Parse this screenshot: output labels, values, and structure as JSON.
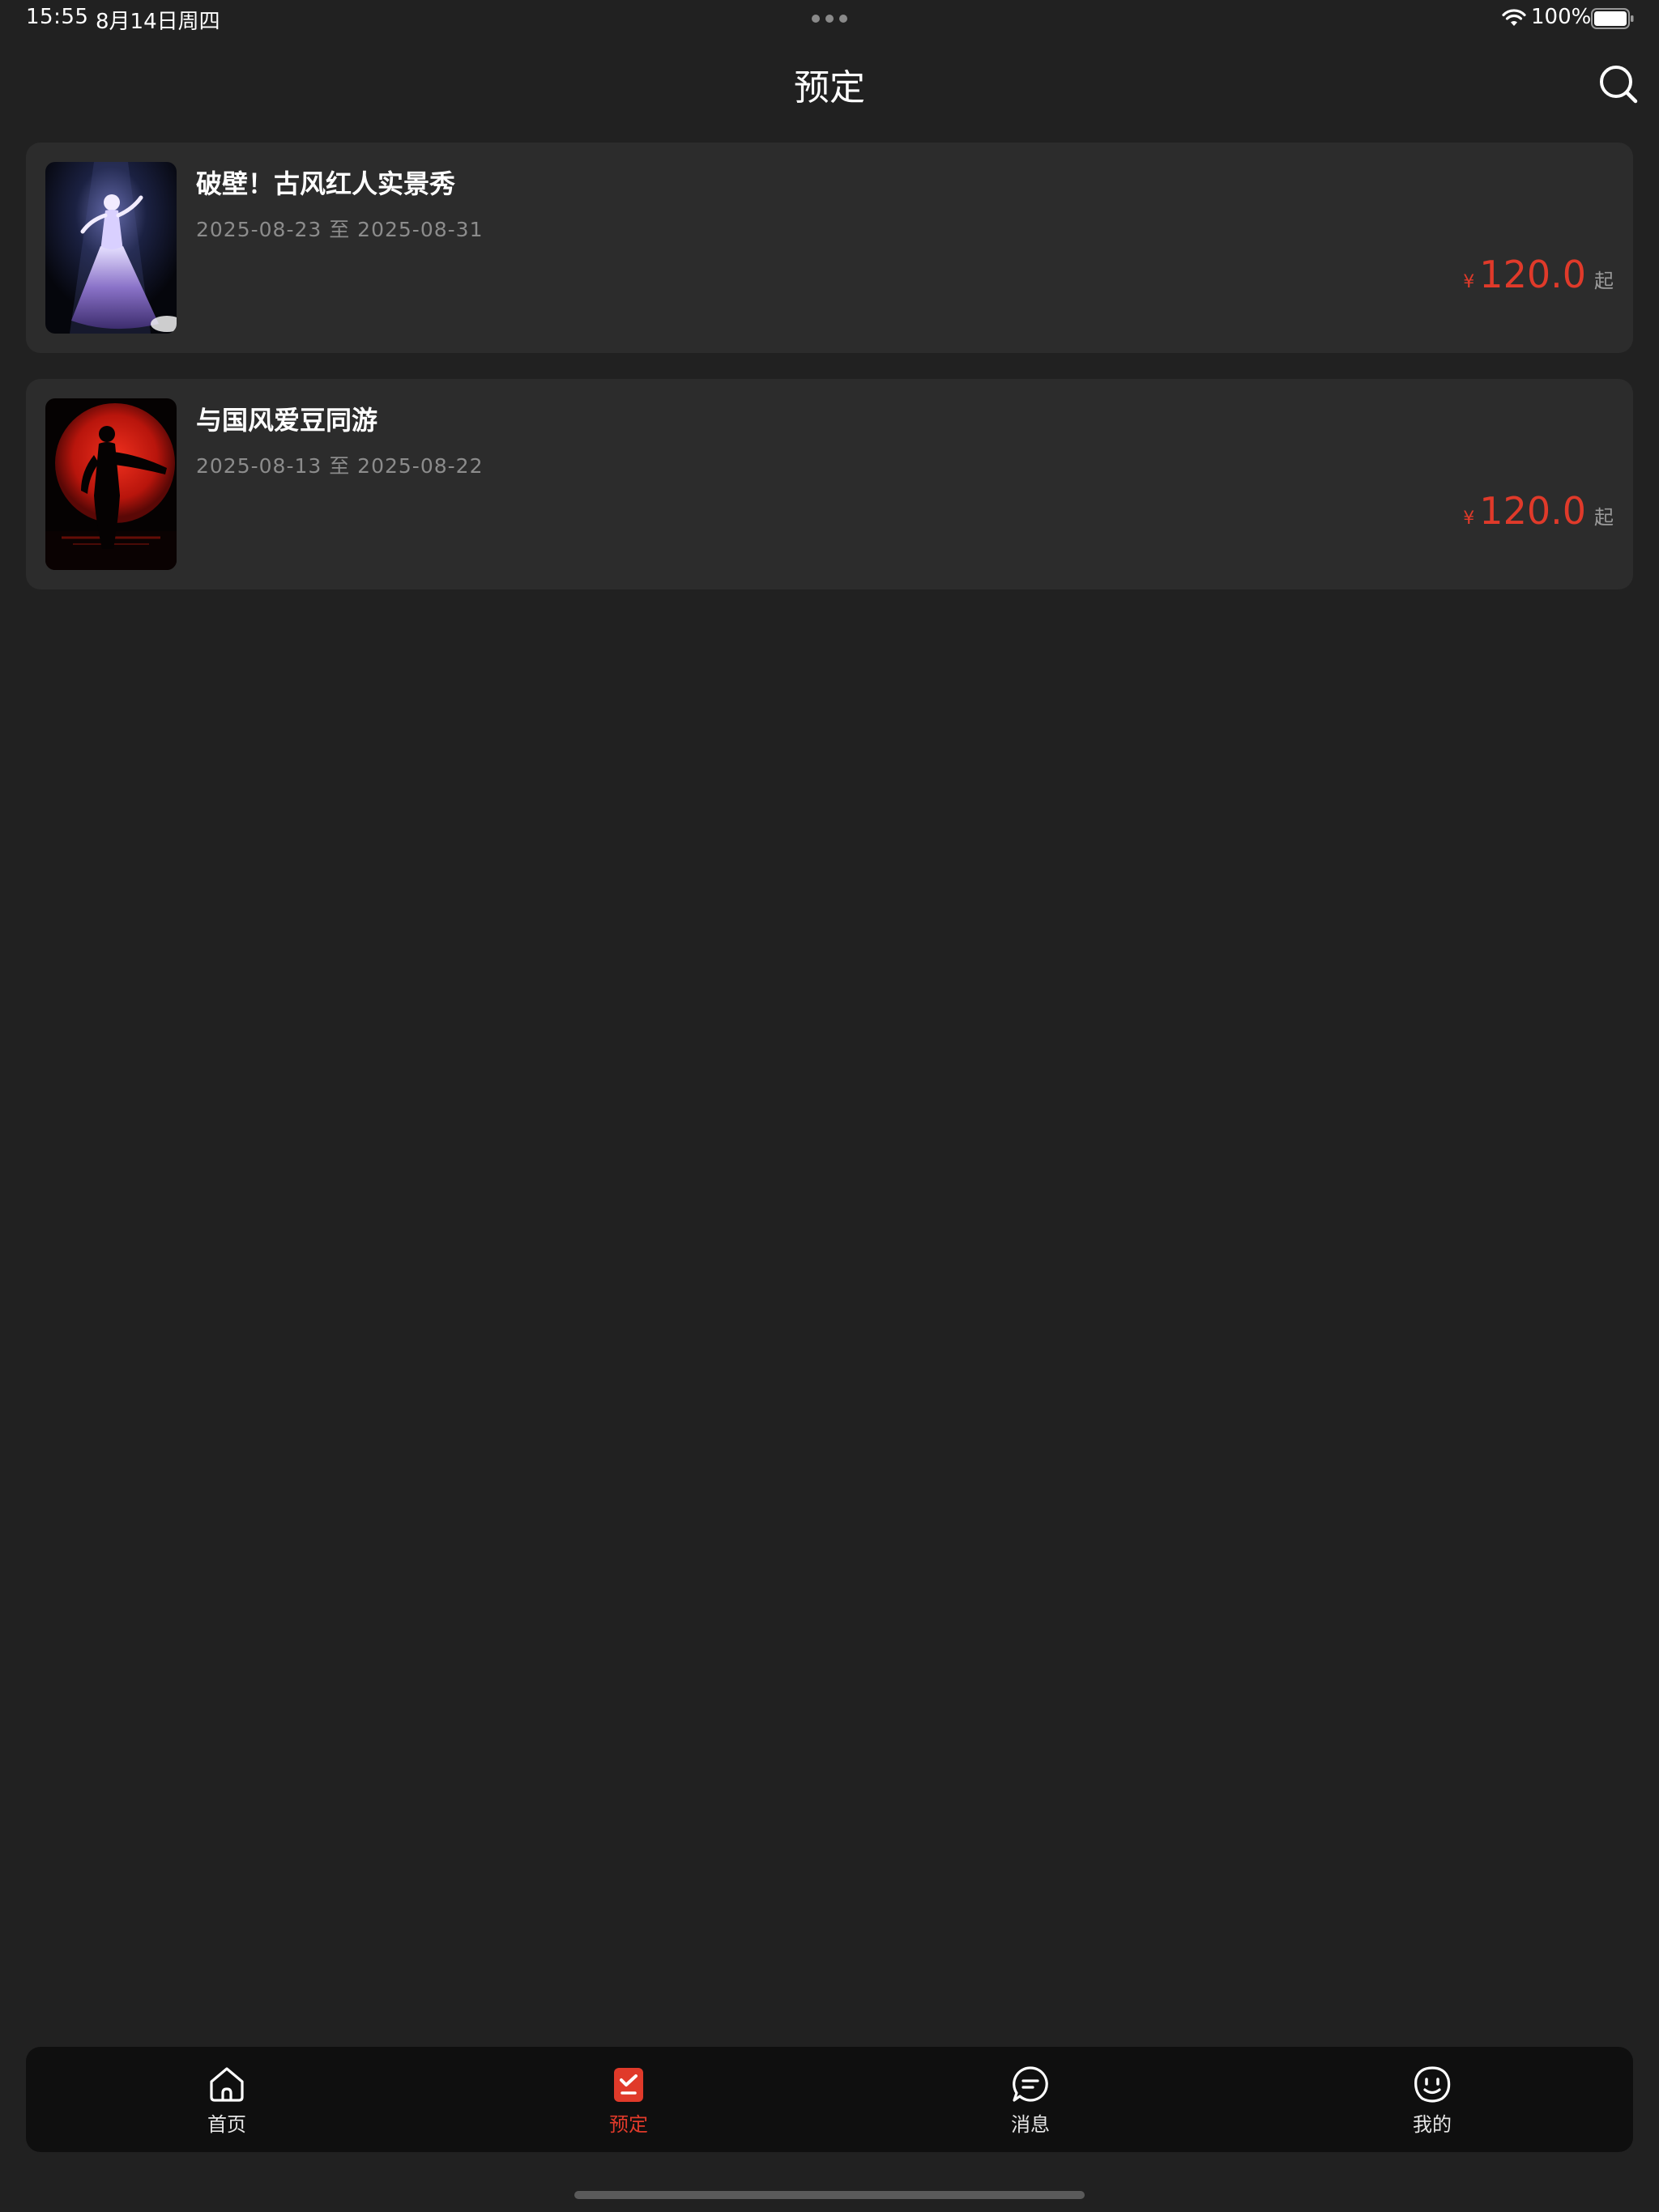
{
  "status_bar": {
    "time": "15:55",
    "date": "8月14日周四",
    "battery": "100%"
  },
  "header": {
    "title": "预定",
    "search_icon": "search-icon"
  },
  "events": [
    {
      "title": "破壁！古风红人实景秀",
      "dates": "2025-08-23 至 2025-08-31",
      "currency": "¥",
      "price": "120.0",
      "price_suffix": "起",
      "thumbnail": "dancer-in-spotlight"
    },
    {
      "title": "与国风爱豆同游",
      "dates": "2025-08-13 至 2025-08-22",
      "currency": "¥",
      "price": "120.0",
      "price_suffix": "起",
      "thumbnail": "silhouette-red-moon"
    }
  ],
  "tab_bar": {
    "tabs": [
      {
        "label": "首页",
        "icon": "home-icon"
      },
      {
        "label": "预定",
        "icon": "booking-icon",
        "active": true
      },
      {
        "label": "消息",
        "icon": "message-icon"
      },
      {
        "label": "我的",
        "icon": "profile-icon"
      }
    ]
  },
  "colors": {
    "background": "#212121",
    "card": "#2c2c2c",
    "accent": "#e03a2a",
    "tab_bar": "#0f0f0f"
  }
}
